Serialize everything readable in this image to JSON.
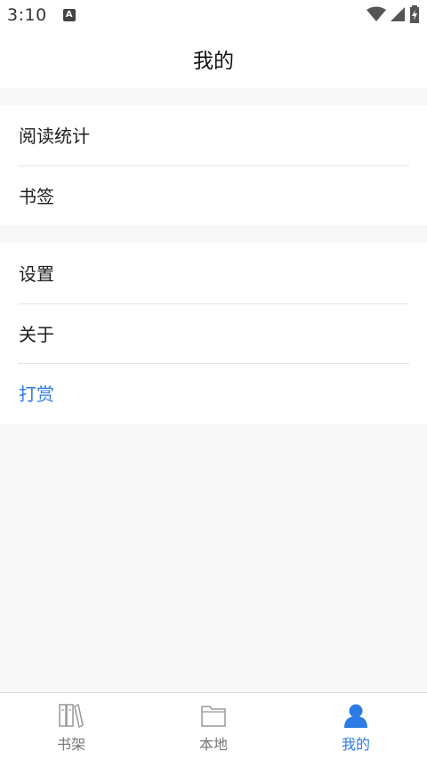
{
  "status_bar": {
    "time": "3:10",
    "notification_badge": "A"
  },
  "header": {
    "title": "我的"
  },
  "menu": {
    "group1": [
      {
        "label": "阅读统计"
      },
      {
        "label": "书签"
      }
    ],
    "group2": [
      {
        "label": "设置"
      },
      {
        "label": "关于"
      },
      {
        "label": "打赏",
        "accent": true
      }
    ]
  },
  "bottom_nav": {
    "items": [
      {
        "label": "书架",
        "icon": "bookshelf-icon"
      },
      {
        "label": "本地",
        "icon": "folder-icon"
      },
      {
        "label": "我的",
        "icon": "person-icon",
        "active": true
      }
    ]
  },
  "colors": {
    "accent": "#2d7be5",
    "background": "#f8f8f8",
    "surface": "#ffffff"
  }
}
